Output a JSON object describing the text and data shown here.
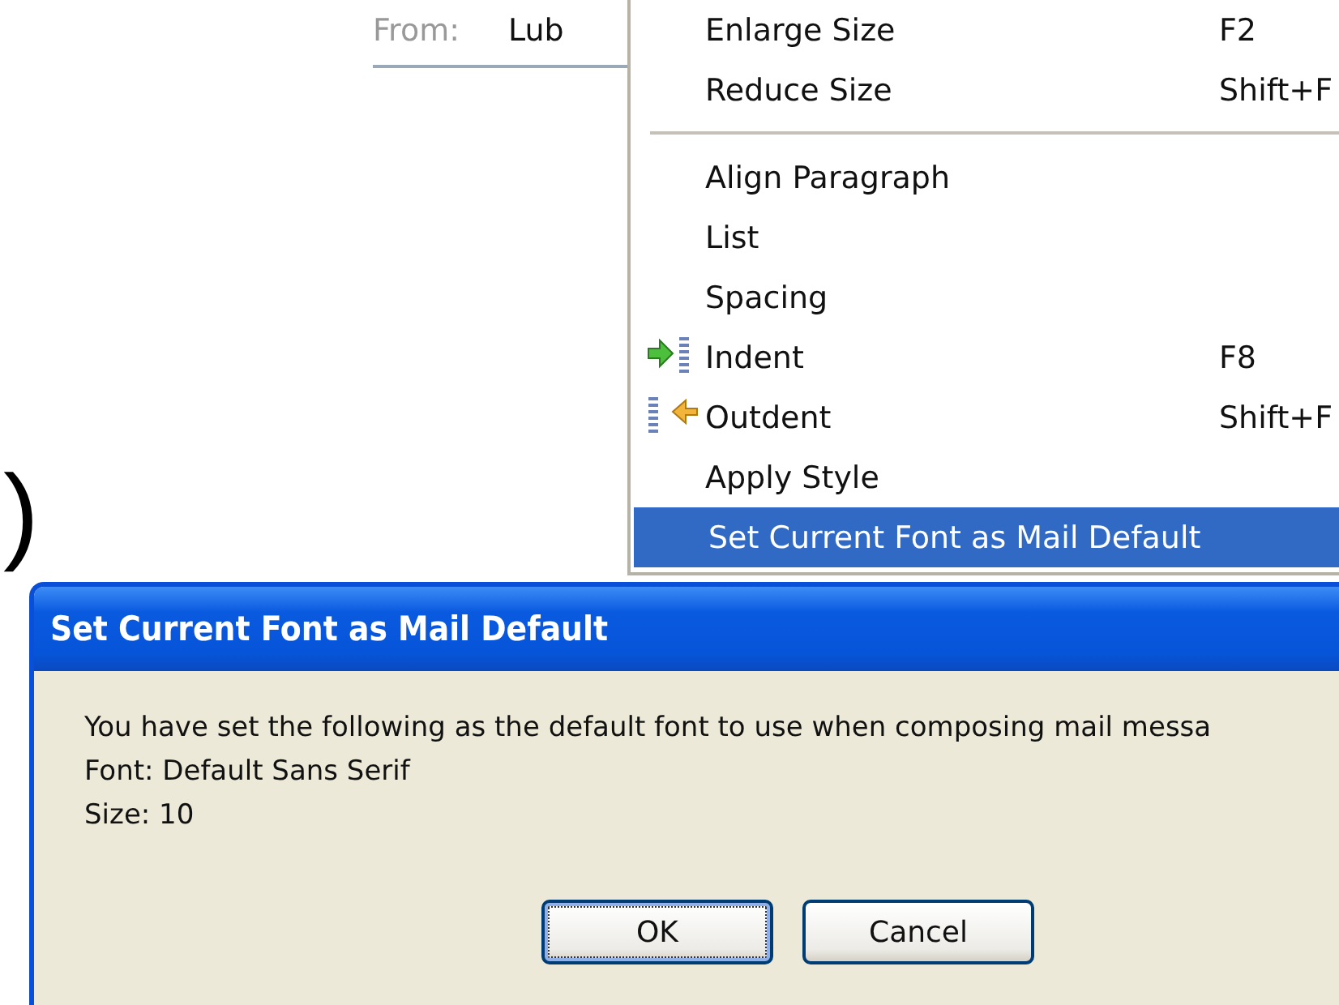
{
  "header": {
    "from_label": "From:",
    "from_value": "Lub"
  },
  "slide_fragment": ")",
  "menu": {
    "items": [
      {
        "kind": "plain",
        "label": "Enlarge Size",
        "shortcut": "F2",
        "selected": false
      },
      {
        "kind": "plain",
        "label": "Reduce Size",
        "shortcut": "Shift+F",
        "selected": false
      },
      {
        "kind": "separator"
      },
      {
        "kind": "plain",
        "label": "Align Paragraph",
        "selected": false
      },
      {
        "kind": "plain",
        "label": "List",
        "selected": false
      },
      {
        "kind": "plain",
        "label": "Spacing",
        "selected": false
      },
      {
        "kind": "indent",
        "label": "Indent",
        "shortcut": "F8",
        "selected": false
      },
      {
        "kind": "outdent",
        "label": "Outdent",
        "shortcut": "Shift+F",
        "selected": false
      },
      {
        "kind": "plain",
        "label": "Apply Style",
        "selected": false
      },
      {
        "kind": "plain",
        "label": "Set Current Font as Mail Default",
        "selected": true
      }
    ]
  },
  "dialog": {
    "title": "Set Current Font as Mail Default",
    "lines": [
      "You have set the following as the default font to use when composing mail messa",
      "Font: Default Sans Serif",
      "Size: 10"
    ],
    "buttons": [
      {
        "label": "OK",
        "focused": true
      },
      {
        "label": "Cancel",
        "focused": false
      }
    ]
  }
}
